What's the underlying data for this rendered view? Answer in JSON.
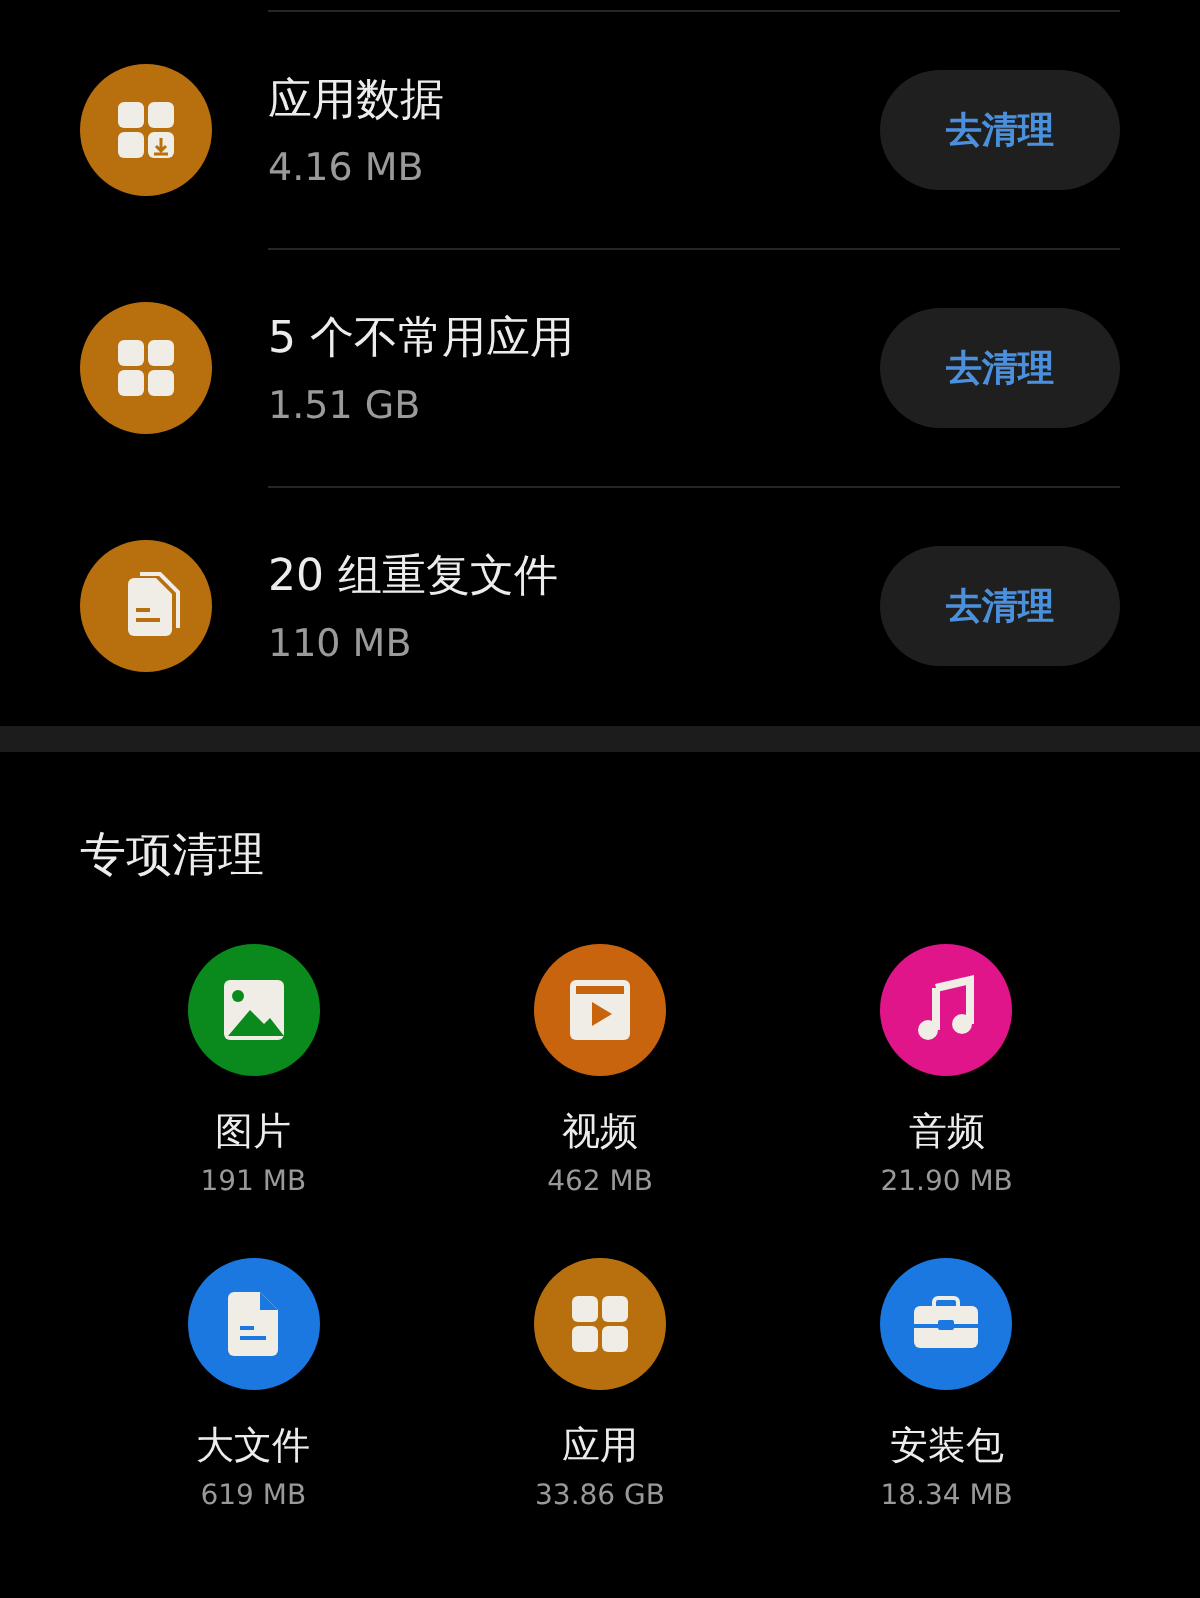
{
  "items": [
    {
      "title": "应用数据",
      "size": "4.16 MB",
      "button": "去清理"
    },
    {
      "title": "5 个不常用应用",
      "size": "1.51 GB",
      "button": "去清理"
    },
    {
      "title": "20 组重复文件",
      "size": "110 MB",
      "button": "去清理"
    }
  ],
  "special": {
    "title": "专项清理",
    "categories": [
      {
        "label": "图片",
        "size": "191 MB",
        "color": "#0a8a1c"
      },
      {
        "label": "视频",
        "size": "462 MB",
        "color": "#c8640e"
      },
      {
        "label": "音频",
        "size": "21.90 MB",
        "color": "#e0158a"
      },
      {
        "label": "大文件",
        "size": "619 MB",
        "color": "#1a78e0"
      },
      {
        "label": "应用",
        "size": "33.86 GB",
        "color": "#b8700e"
      },
      {
        "label": "安装包",
        "size": "18.34 MB",
        "color": "#1a78e0"
      }
    ]
  }
}
